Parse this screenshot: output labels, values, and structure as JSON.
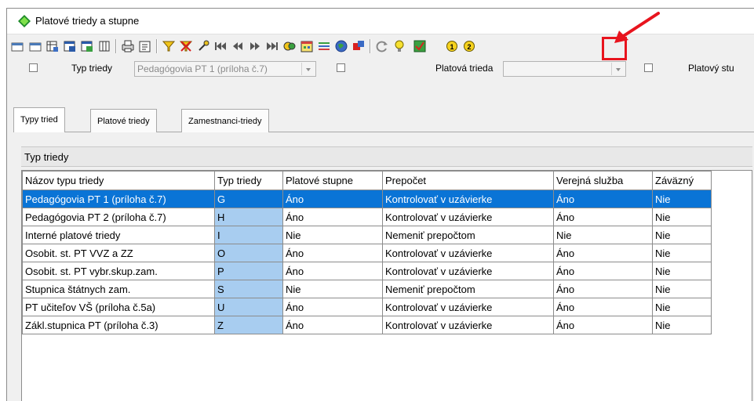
{
  "window": {
    "title": "Platové triedy a stupne"
  },
  "toolbar": {
    "buttons": [
      "first-record-icon",
      "prev-record-icon",
      "filter-table-icon",
      "calc-table-icon",
      "calc2-icon",
      "delete-record-icon",
      "print-icon",
      "report-icon",
      "filter-icon",
      "clear-filter-icon",
      "pin-icon",
      "first-icon",
      "prev-icon",
      "next-icon",
      "last-icon",
      "link-icon",
      "calendar-icon",
      "bars-icon",
      "globe-icon",
      "export-icon",
      "refresh-icon",
      "bulb-icon",
      "check-icon",
      "option-1-icon",
      "option-2-icon"
    ],
    "option1": "1",
    "option2": "2",
    "highlight_color": "#e8141e"
  },
  "filters": {
    "typ_label": "Typ triedy",
    "typ_value": "Pedagógovia PT 1 (príloha č.7)",
    "platova_label": "Platová trieda",
    "platova_value": "",
    "stupen_label": "Platový stu"
  },
  "tabs": [
    "Typy tried",
    "Platové triedy",
    "Zamestnanci-triedy"
  ],
  "section": {
    "title": "Typ triedy"
  },
  "table": {
    "columns": [
      "Názov typu triedy",
      "Typ triedy",
      "Platové stupne",
      "Prepočet",
      "Verejná služba",
      "Záväzný"
    ],
    "rows": [
      [
        "Pedagógovia PT 1 (príloha č.7)",
        "G",
        "Áno",
        "Kontrolovať v uzávierke",
        "Áno",
        "Nie"
      ],
      [
        "Pedagógovia PT 2 (príloha č.7)",
        "H",
        "Áno",
        "Kontrolovať v uzávierke",
        "Áno",
        "Nie"
      ],
      [
        "Interné platové triedy",
        "I",
        "Nie",
        "Nemeniť prepočtom",
        "Nie",
        "Nie"
      ],
      [
        "Osobit. st. PT VVZ a ZZ",
        "O",
        "Áno",
        "Kontrolovať v uzávierke",
        "Áno",
        "Nie"
      ],
      [
        "Osobit. st. PT vybr.skup.zam.",
        "P",
        "Áno",
        "Kontrolovať v uzávierke",
        "Áno",
        "Nie"
      ],
      [
        "Stupnica štátnych zam.",
        "S",
        "Nie",
        "Nemeniť prepočtom",
        "Áno",
        "Nie"
      ],
      [
        "PT učiteľov VŠ (príloha č.5a)",
        "U",
        "Áno",
        "Kontrolovať v uzávierke",
        "Áno",
        "Nie"
      ],
      [
        "Zákl.stupnica PT (príloha č.3)",
        "Z",
        "Áno",
        "Kontrolovať v uzávierke",
        "Áno",
        "Nie"
      ]
    ],
    "selected_row": 0,
    "selection_color": "#0a74d6",
    "code_column_color": "#a8cdf0"
  }
}
